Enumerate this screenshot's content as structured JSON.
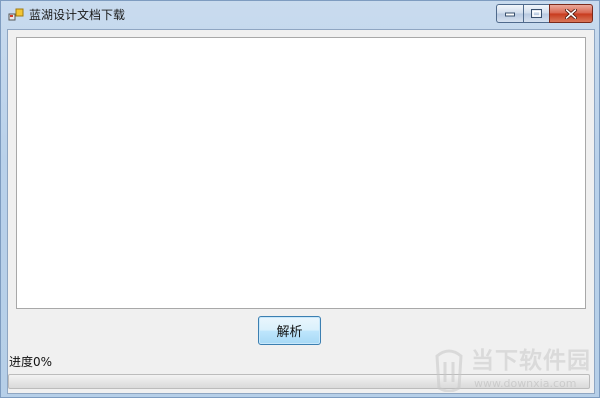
{
  "window": {
    "title": "蓝湖设计文档下载"
  },
  "main": {
    "output_text": "",
    "parse_button_label": "解析",
    "progress_label": "进度0%",
    "progress_value": 0
  },
  "watermark": {
    "brand": "当下软件园",
    "url": "www.downxia.com"
  },
  "colors": {
    "titlebar": "#b9d1ea",
    "close_button": "#c7391c",
    "button_border": "#3c7fb1"
  }
}
